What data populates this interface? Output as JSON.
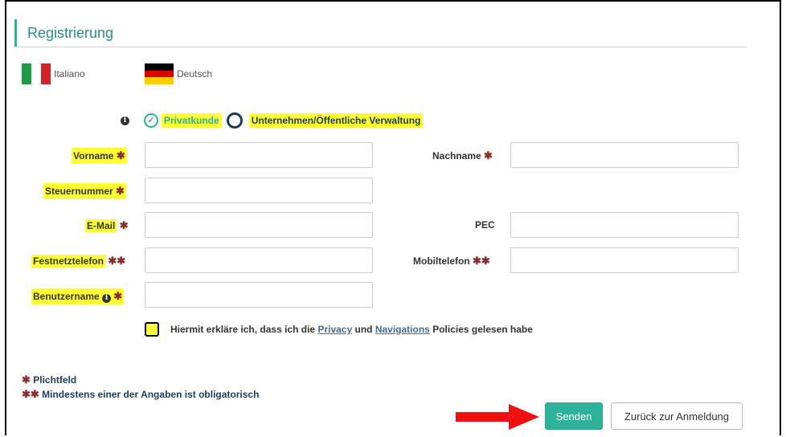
{
  "header": {
    "title": "Registrierung"
  },
  "languages": [
    {
      "label": "Italiano",
      "icon": "flag-italy-icon"
    },
    {
      "label": "Deutsch",
      "icon": "flag-germany-icon"
    }
  ],
  "customer_type": {
    "options": [
      "Privatkunde",
      "Unternehmen/Öffentliche Verwaltung"
    ],
    "selected": "Privatkunde"
  },
  "form": {
    "vorname_label": "Vorname",
    "nachname_label": "Nachname",
    "steuernummer_label": "Steuernummer",
    "email_label": "E-Mail",
    "pec_label": "PEC",
    "festnetz_label": "Festnetztelefon",
    "mobil_label": "Mobiltelefon",
    "benutzername_label": "Benutzername",
    "star": "✱",
    "double_star": "✱✱"
  },
  "consent": {
    "prefix": "Hiermit erkläre ich, dass ich die",
    "privacy_link": "Privacy",
    "and": "und",
    "nav_link": "Navigations",
    "suffix": "Policies gelesen habe"
  },
  "legend": {
    "required": "Plichtfeld",
    "one_required": "Mindestens einer der Angaben ist obligatorisch"
  },
  "buttons": {
    "submit": "Senden",
    "back": "Zurück zur Anmeldung"
  },
  "colors": {
    "accent": "#2eb39a",
    "highlight": "#ffff33",
    "required_star": "#8b2e2e",
    "arrow": "#ee1111"
  }
}
